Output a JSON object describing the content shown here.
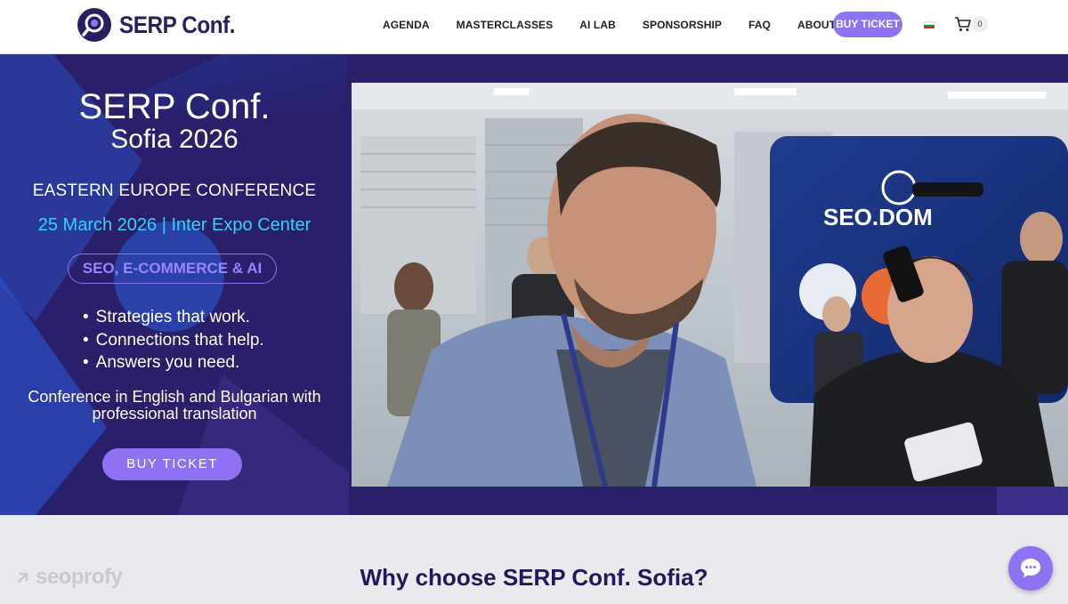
{
  "header": {
    "logo_text": "SERP Conf.",
    "nav": [
      "AGENDA",
      "MASTERCLASSES",
      "AI LAB",
      "SPONSORSHIP",
      "FAQ",
      "ABOUT US"
    ],
    "cta_label": "BUY TICKET",
    "flag_icon": "bulgaria-flag-icon",
    "cart_icon": "shopping-cart-icon",
    "cart_count": "0"
  },
  "hero": {
    "title": "SERP Conf.",
    "subtitle": "Sofia 2026",
    "eyebrow": "EASTERN EUROPE CONFERENCE",
    "date_venue": "25 March 2026 | Inter Expo Center",
    "pill": "SEO, E-COMMERCE & AI",
    "bullets": [
      "Strategies that work.",
      "Connections that help.",
      "Answers you need."
    ],
    "note": "Conference in English and Bulgarian with professional translation",
    "cta_label": "BUY TICKET",
    "booth_sign": "SEO.DOM"
  },
  "section": {
    "title": "Why choose SERP Conf. Sofia?",
    "sponsor_badge": "seoprofy"
  },
  "chat_icon": "chat-bubble-icon",
  "colors": {
    "brand_dark": "#27205e",
    "accent_purple": "#8f72f3",
    "hero_bg": "#2a1f6a",
    "cyan": "#2fd6f5"
  }
}
